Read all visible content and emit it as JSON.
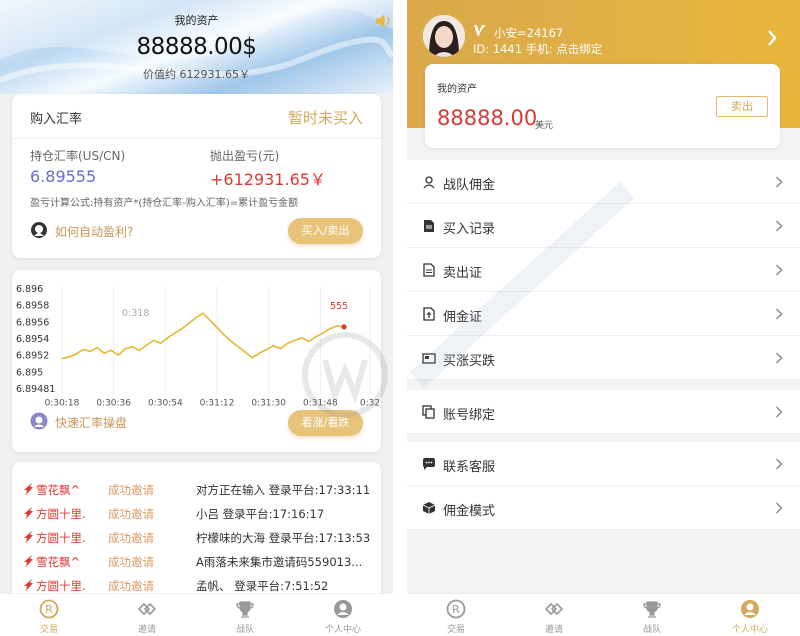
{
  "left": {
    "hero": {
      "label": "我的资产",
      "amount": "88888.00$",
      "sub": "价值约 612931.65￥"
    },
    "rate_card": {
      "title": "购入汇率",
      "status": "暂时未买入",
      "hold_label": "持仓汇率(US/CN)",
      "hold_value": "6.89555",
      "pl_label": "抛出盈亏(元)",
      "pl_value": "+612931.65￥",
      "formula": "盈亏计算公式:持有资产*(持仓汇率-购入汇率)=累计盈亏金额",
      "help": "如何自动盈利?",
      "button": "买入/卖出"
    },
    "chart_card": {
      "label": "快速汇率操盘",
      "button": "看涨/看跌"
    },
    "invites": [
      {
        "name": "雪花飘^",
        "status": "成功邀请",
        "detail": "对方正在输入 登录平台:17:33:11"
      },
      {
        "name": "方圆十里.",
        "status": "成功邀请",
        "detail": "小吕 登录平台:17:16:17"
      },
      {
        "name": "方圆十里.",
        "status": "成功邀请",
        "detail": "柠檬味的大海 登录平台:17:13:53"
      },
      {
        "name": "雪花飘^",
        "status": "成功邀请",
        "detail": "A雨落未来集市邀请码559013..."
      },
      {
        "name": "方圆十里.",
        "status": "成功邀请",
        "detail": "孟帆、 登录平台:7:51:52"
      }
    ],
    "tabs": [
      {
        "label": "交易",
        "icon": "trade-icon",
        "active": true
      },
      {
        "label": "邀请",
        "icon": "invite-icon",
        "active": false
      },
      {
        "label": "战队",
        "icon": "trophy-icon",
        "active": false
      },
      {
        "label": "个人中心",
        "icon": "user-icon",
        "active": false
      }
    ]
  },
  "chart_data": {
    "type": "line",
    "yticks": [
      "6.896",
      "6.8958",
      "6.8956",
      "6.8954",
      "6.8952",
      "6.895",
      "6.89481"
    ],
    "xticks": [
      "0:30:18",
      "0:30:36",
      "0:30:54",
      "0:31:12",
      "0:31:30",
      "0:31:48",
      "0:32"
    ],
    "ylim": [
      6.89481,
      6.896
    ],
    "annotations": [
      {
        "text": "0:318"
      },
      {
        "text": "555"
      }
    ],
    "series": [
      {
        "values": [
          6.8952,
          6.89522,
          6.89525,
          6.8953,
          6.89528,
          6.89532,
          6.89526,
          6.89529,
          6.89524,
          6.89531,
          6.89533,
          6.89529,
          6.89535,
          6.8954,
          6.89537,
          6.89543,
          6.89548,
          6.89553,
          6.89559,
          6.89565,
          6.8957,
          6.89562,
          6.89554,
          6.89546,
          6.89539,
          6.89533,
          6.89527,
          6.89521,
          6.89526,
          6.8953,
          6.89534,
          6.89531,
          6.89537,
          6.8954,
          6.89543,
          6.89539,
          6.89544,
          6.89548,
          6.89553,
          6.89556,
          6.89555
        ]
      }
    ]
  },
  "right": {
    "profile": {
      "name": "小安=24167",
      "id_line": "ID: 1441 手机: 点击绑定"
    },
    "asset": {
      "label": "我的资产",
      "amount": "88888.00",
      "unit": "美元",
      "button": "卖出"
    },
    "menu1": [
      {
        "label": "战队佣金",
        "icon": "user-outline-icon"
      },
      {
        "label": "买入记录",
        "icon": "document-icon"
      },
      {
        "label": "卖出证",
        "icon": "certificate-icon"
      },
      {
        "label": "佣金证",
        "icon": "commission-icon"
      },
      {
        "label": "买涨买跌",
        "icon": "card-icon"
      }
    ],
    "menu2": [
      {
        "label": "账号绑定",
        "icon": "copy-icon"
      }
    ],
    "menu3": [
      {
        "label": "联系客服",
        "icon": "chat-icon"
      },
      {
        "label": "佣金模式",
        "icon": "box-icon"
      }
    ],
    "tabs": [
      {
        "label": "交易",
        "icon": "trade-icon",
        "active": false
      },
      {
        "label": "邀请",
        "icon": "invite-icon",
        "active": false
      },
      {
        "label": "战队",
        "icon": "trophy-icon",
        "active": false
      },
      {
        "label": "个人中心",
        "icon": "user-icon",
        "active": true
      }
    ]
  },
  "colors": {
    "gold": "#d4a85a",
    "red": "#e2372f",
    "purple": "#6a6ad0",
    "line": "#e6b634"
  }
}
